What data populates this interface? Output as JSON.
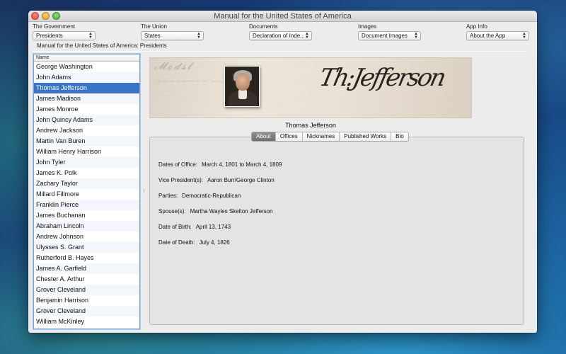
{
  "window": {
    "title": "Manual for the United States of America"
  },
  "toolbar": {
    "groups": [
      {
        "label": "The Government",
        "value": "Presidents"
      },
      {
        "label": "The Union",
        "value": "States"
      },
      {
        "label": "Documents",
        "value": "Declaration of Inde..."
      },
      {
        "label": "Images",
        "value": "Document Images"
      },
      {
        "label": "App Info",
        "value": "About the App"
      }
    ],
    "path": "Manual for the United States of America:  Presidents"
  },
  "list": {
    "header": "Name",
    "selected_index": 2,
    "items": [
      "George Washington",
      "John Adams",
      "Thomas Jefferson",
      "James Madison",
      "James Monroe",
      "John Quincy Adams",
      "Andrew Jackson",
      "Martin Van Buren",
      "William Henry Harrison",
      "John Tyler",
      "James K. Polk",
      "Zachary Taylor",
      "Millard Fillmore",
      "Franklin Pierce",
      "James Buchanan",
      "Abraham Lincoln",
      "Andrew Johnson",
      "Ulysses S. Grant",
      "Rutherford B. Hayes",
      "James A. Garfield",
      "Chester A. Arthur",
      "Grover Cleveland",
      "Benjamin Harrison",
      "Grover Cleveland",
      "William McKinley"
    ]
  },
  "detail": {
    "name": "Thomas Jefferson",
    "signature": "Th:Jefferson",
    "tabs": [
      "About",
      "Offices",
      "Nicknames",
      "Published Works",
      "Bio"
    ],
    "active_tab": 0,
    "fields": [
      {
        "label": "Dates of Office:",
        "value": "March 4, 1801 to March 4, 1809"
      },
      {
        "label": "Vice President(s):",
        "value": "Aaron Burr/George Clinton"
      },
      {
        "label": "Parties:",
        "value": "Democratic-Republican"
      },
      {
        "label": "Spouse(s):",
        "value": "Martha Wayles Skelton Jefferson"
      },
      {
        "label": "Date of Birth:",
        "value": "April 13, 1743"
      },
      {
        "label": "Date of Death:",
        "value": "July 4, 1826"
      }
    ]
  },
  "colors": {
    "selection": "#3a74c7",
    "active_tab": "#7d7d7d"
  }
}
